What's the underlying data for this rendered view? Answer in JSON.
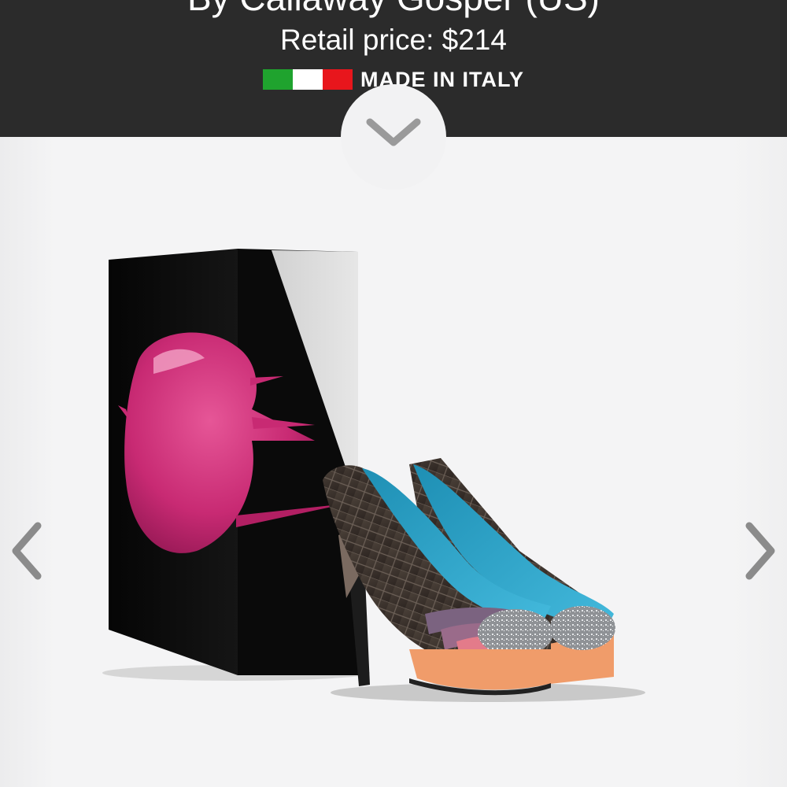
{
  "header": {
    "designer": "By Callaway Gosper (US)",
    "price": "Retail price: $214",
    "made_in": "MADE IN ITALY",
    "flag_colors": [
      "#1fa32e",
      "#ffffff",
      "#e8161c"
    ],
    "background": "#2b2b2b"
  },
  "icons": {
    "expand": "chevron-down-icon",
    "previous": "chevron-left-icon",
    "next": "chevron-right-icon"
  },
  "product_image": {
    "box_accent": "#d4307a",
    "lining": "#2aa6c8",
    "platform": "#f09c6a"
  }
}
